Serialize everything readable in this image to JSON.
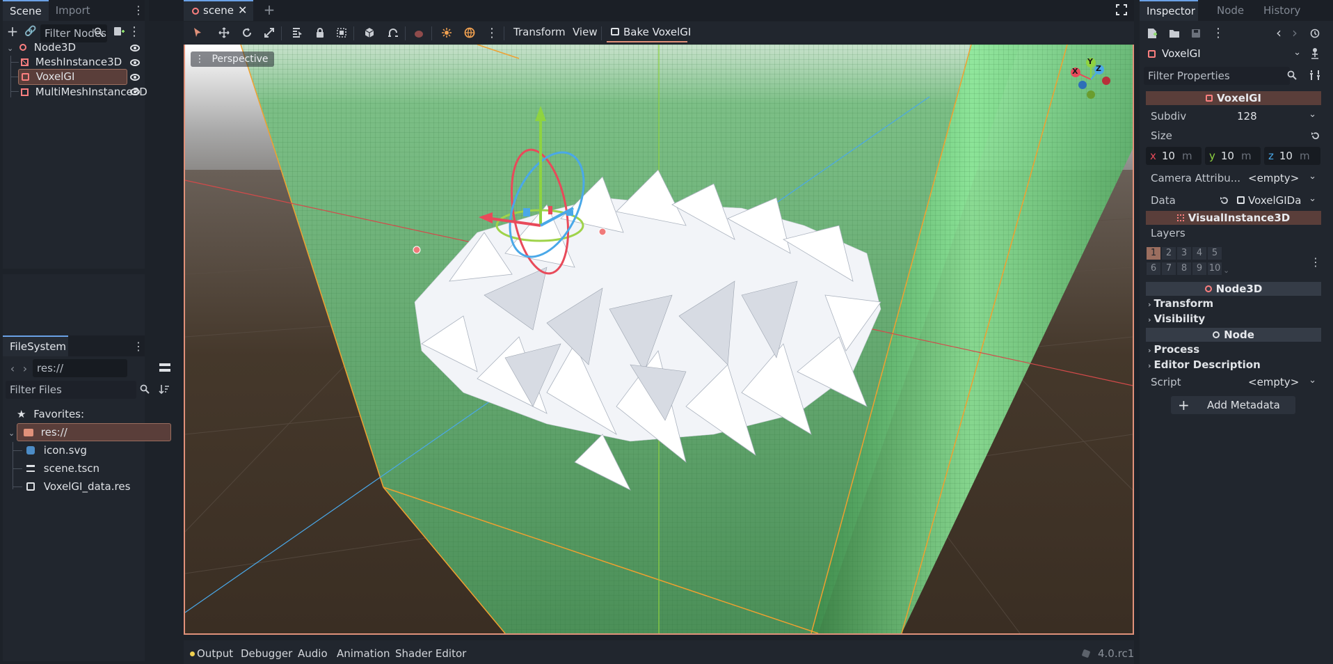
{
  "scene_dock": {
    "tabs": [
      "Scene",
      "Import"
    ],
    "filter_placeholder": "Filter Nodes",
    "tree": [
      {
        "label": "Node3D",
        "icon": "node3d-icon"
      },
      {
        "label": "MeshInstance3D",
        "icon": "mesh-instance-icon"
      },
      {
        "label": "VoxelGI",
        "icon": "voxelgi-icon",
        "selected": true
      },
      {
        "label": "MultiMeshInstance3D",
        "icon": "multimesh-icon"
      }
    ]
  },
  "filesystem_dock": {
    "tab": "FileSystem",
    "path": "res://",
    "filter_placeholder": "Filter Files",
    "favorites_label": "Favorites:",
    "root_label": "res://",
    "files": [
      "icon.svg",
      "scene.tscn",
      "VoxelGI_data.res"
    ]
  },
  "editor": {
    "scene_tab": "scene",
    "menus": {
      "transform": "Transform",
      "view": "View",
      "bake": "Bake VoxelGI"
    },
    "viewport_label": "Perspective",
    "gizmo_axes": {
      "x": "X",
      "y": "Y",
      "z": "Z"
    }
  },
  "inspector": {
    "tabs": [
      "Inspector",
      "Node",
      "History"
    ],
    "node_selector": "VoxelGI",
    "filter_placeholder": "Filter Properties",
    "class_header": "VoxelGI",
    "subdiv_label": "Subdiv",
    "subdiv_value": "128",
    "size_label": "Size",
    "size": {
      "x": "10",
      "y": "10",
      "z": "10",
      "unit": "m"
    },
    "camera_attr_label": "Camera Attribu...",
    "camera_attr_value": "<empty>",
    "data_label": "Data",
    "data_value": "VoxelGIDa",
    "visual_header": "VisualInstance3D",
    "layers_label": "Layers",
    "layers_row1": [
      "1",
      "2",
      "3",
      "4",
      "5"
    ],
    "layers_row2": [
      "6",
      "7",
      "8",
      "9",
      "10"
    ],
    "node3d_header": "Node3D",
    "transform_label": "Transform",
    "visibility_label": "Visibility",
    "node_header": "Node",
    "process_label": "Process",
    "editor_desc_label": "Editor Description",
    "script_label": "Script",
    "script_value": "<empty>",
    "add_metadata": "Add Metadata"
  },
  "bottom_panel": {
    "tabs": [
      "Output",
      "Debugger",
      "Audio",
      "Animation",
      "Shader Editor"
    ],
    "version": "4.0.rc1"
  },
  "colors": {
    "accent": "#6aa1e6",
    "selection": "#5a3e3a",
    "node_red": "#fc7f7f"
  }
}
